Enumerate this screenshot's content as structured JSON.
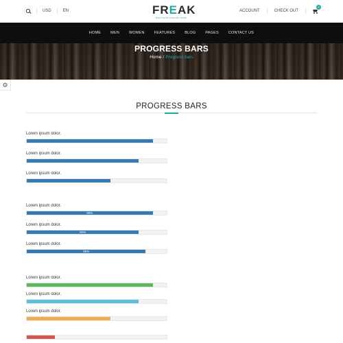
{
  "topbar": {
    "currency": "USD",
    "language": "EN",
    "account": "ACCOUNT",
    "checkout": "CHECK OUT",
    "cart_count": "0"
  },
  "logo": {
    "text_a": "FR",
    "text_b": "E",
    "text_c": "AK",
    "tagline": "BOUTIQUE FASHION SHOP"
  },
  "nav": [
    "HOME",
    "MEN",
    "WOMEN",
    "FEATURES",
    "BLOG",
    "PAGES",
    "CONTACT US"
  ],
  "banner": {
    "title": "PROGRESS BARS",
    "crumb_home": "Home",
    "crumb_sep": "/",
    "crumb_current": "Progress bars"
  },
  "section": {
    "title": "PROGRESS BARS"
  },
  "colors": {
    "accent": "#1aaba0",
    "blue": "#337ab7",
    "green": "#5cb85c",
    "light_blue": "#5bc0de",
    "orange": "#f0ad4e",
    "red": "#d9534f"
  },
  "groups": [
    {
      "bars": [
        {
          "label": "Lorem ipsum dolor.",
          "percent": 90,
          "text": "",
          "color": "#337ab7"
        },
        {
          "label": "Lorem ipsum dolor.",
          "percent": 80,
          "text": "",
          "color": "#337ab7"
        },
        {
          "label": "Lorem ipsum dolor.",
          "percent": 60,
          "text": "",
          "color": "#337ab7"
        }
      ]
    },
    {
      "bars": [
        {
          "label": "Lorem ipsum dolor.",
          "percent": 90,
          "text": "90%",
          "color": "#337ab7"
        },
        {
          "label": "Lorem ipsum dolor.",
          "percent": 80,
          "text": "80%",
          "color": "#337ab7"
        },
        {
          "label": "Lorem ipsum dolor.",
          "percent": 85,
          "text": "85%",
          "color": "#337ab7"
        }
      ]
    },
    {
      "bars": [
        {
          "label": "Lorem ipsum dolor.",
          "percent": 90,
          "text": "",
          "color": "#5cb85c"
        },
        {
          "label": "Lorem ipsum dolor.",
          "percent": 80,
          "text": "",
          "color": "#5bc0de"
        },
        {
          "label": "Lorem ipsum dolor.",
          "percent": 60,
          "text": "",
          "color": "#f0ad4e"
        },
        {
          "label": "",
          "percent": 20,
          "text": "",
          "color": "#d9534f"
        }
      ]
    }
  ]
}
